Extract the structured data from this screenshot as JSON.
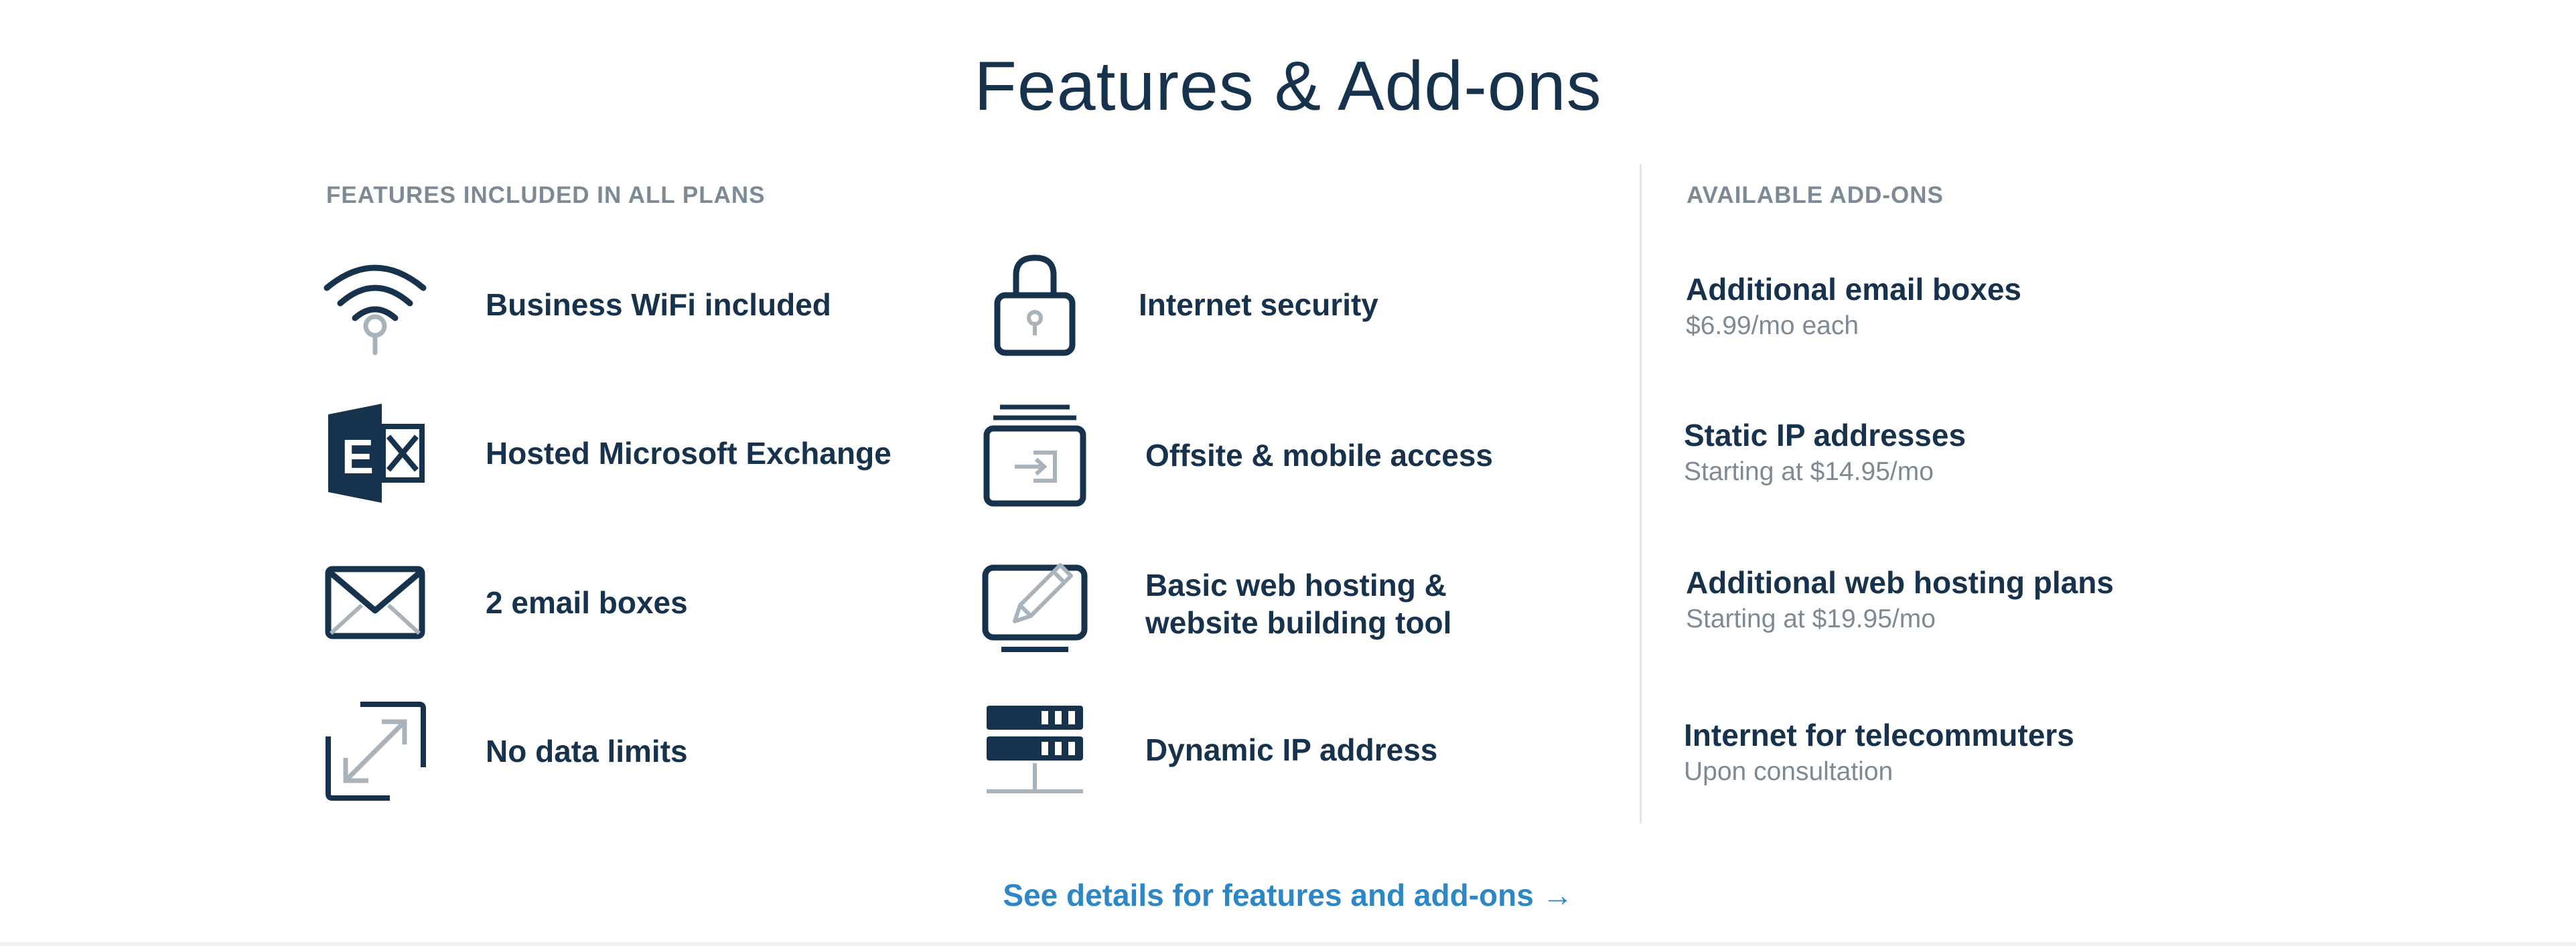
{
  "title": "Features & Add-ons",
  "features_section": {
    "label": "FEATURES INCLUDED IN ALL PLANS",
    "items": [
      {
        "icon": "wifi-icon",
        "label": "Business WiFi included"
      },
      {
        "icon": "exchange-icon",
        "label": "Hosted Microsoft Exchange"
      },
      {
        "icon": "envelope-icon",
        "label": "2 email boxes"
      },
      {
        "icon": "expand-icon",
        "label": "No data limits"
      },
      {
        "icon": "lock-icon",
        "label": "Internet security"
      },
      {
        "icon": "folder-access-icon",
        "label": "Offsite & mobile access"
      },
      {
        "icon": "monitor-pencil-icon",
        "label_line1": "Basic web hosting &",
        "label_line2": "website building tool"
      },
      {
        "icon": "server-icon",
        "label": "Dynamic IP address"
      }
    ]
  },
  "addons_section": {
    "label": "AVAILABLE ADD-ONS",
    "items": [
      {
        "name": "Additional email boxes",
        "price": "$6.99/mo each"
      },
      {
        "name": "Static IP addresses",
        "price": "Starting at $14.95/mo"
      },
      {
        "name": "Additional web hosting plans",
        "price": "Starting at $19.95/mo"
      },
      {
        "name": "Internet for telecommuters",
        "price": "Upon consultation"
      }
    ]
  },
  "details_link": "See details for features and add-ons →",
  "colors": {
    "navy": "#17324d",
    "gray": "#7d8a96",
    "icon_gray": "#a9b3bb",
    "link_blue": "#2d87c7"
  }
}
